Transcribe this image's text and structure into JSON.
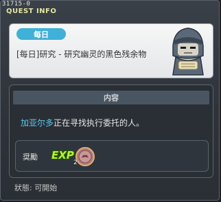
{
  "window": {
    "quest_id": "31715-0",
    "title": "QUEST INFO"
  },
  "header": {
    "badge": "每日",
    "quest_name": "[每日]研究 - 研究幽灵的黑色残余物"
  },
  "content": {
    "header": "内容",
    "npc_name": "加亚尔多",
    "description_rest": "正在寻找执行委托的人。"
  },
  "reward": {
    "label": "奨勵",
    "exp_label": "EXP",
    "item_count": "2"
  },
  "status": {
    "text": "狀態:  可開始"
  },
  "colors": {
    "badge": "#3fb0d8",
    "npc_link": "#5cc8f0",
    "exp": "#b6f23c",
    "title": "#e3e8a0"
  }
}
